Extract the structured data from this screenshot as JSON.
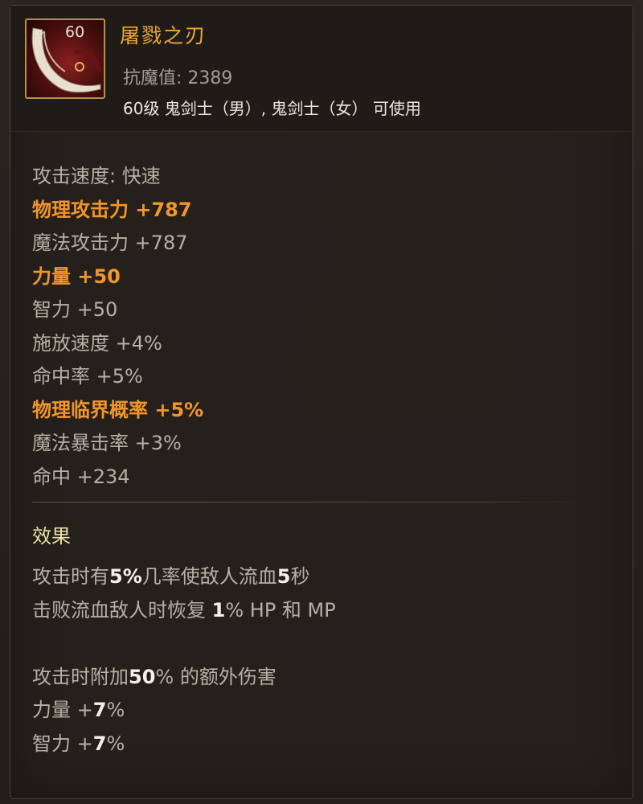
{
  "item": {
    "name": "屠戮之刃",
    "level_label": "Lv.",
    "level_value": "60",
    "resist_label": "抗魔值: 2389",
    "usable_text": "60级 鬼剑士（男）, 鬼剑士（女） 可使用"
  },
  "stats": [
    {
      "text": "攻击速度: 快速",
      "highlight": false
    },
    {
      "text": "物理攻击力 +787",
      "highlight": true
    },
    {
      "text": "魔法攻击力 +787",
      "highlight": false
    },
    {
      "text": "力量 +50",
      "highlight": true
    },
    {
      "text": "智力 +50",
      "highlight": false
    },
    {
      "text": "施放速度 +4%",
      "highlight": false
    },
    {
      "text": "命中率 +5%",
      "highlight": false
    },
    {
      "text": "物理临界概率 +5%",
      "highlight": true
    },
    {
      "text": "魔法暴击率 +3%",
      "highlight": false
    },
    {
      "text": "命中 +234",
      "highlight": false
    }
  ],
  "effect": {
    "title": "效果",
    "lines": [
      {
        "parts": [
          {
            "t": "攻击时有"
          },
          {
            "t": "5%",
            "b": true
          },
          {
            "t": "几率使敌人流血"
          },
          {
            "t": "5",
            "b": true
          },
          {
            "t": "秒"
          }
        ]
      },
      {
        "parts": [
          {
            "t": "击败流血敌人时恢复 "
          },
          {
            "t": "1",
            "b": true
          },
          {
            "t": "% HP 和 MP"
          }
        ]
      },
      {
        "parts": []
      },
      {
        "parts": [
          {
            "t": "攻击时附加"
          },
          {
            "t": "50",
            "b": true
          },
          {
            "t": "% 的额外伤害"
          }
        ]
      },
      {
        "parts": [
          {
            "t": "力量 +"
          },
          {
            "t": "7",
            "b": true
          },
          {
            "t": "%"
          }
        ]
      },
      {
        "parts": [
          {
            "t": "智力 +"
          },
          {
            "t": "7",
            "b": true
          },
          {
            "t": "%"
          }
        ]
      }
    ]
  },
  "colors": {
    "item_name": "#f0a638",
    "highlight_stat": "#f2962a",
    "normal_stat": "#b7b0a6",
    "effect_title": "#efdfa8",
    "emphasis": "#f4f1ea"
  },
  "icons": {
    "item_icon": "blade-icon"
  }
}
